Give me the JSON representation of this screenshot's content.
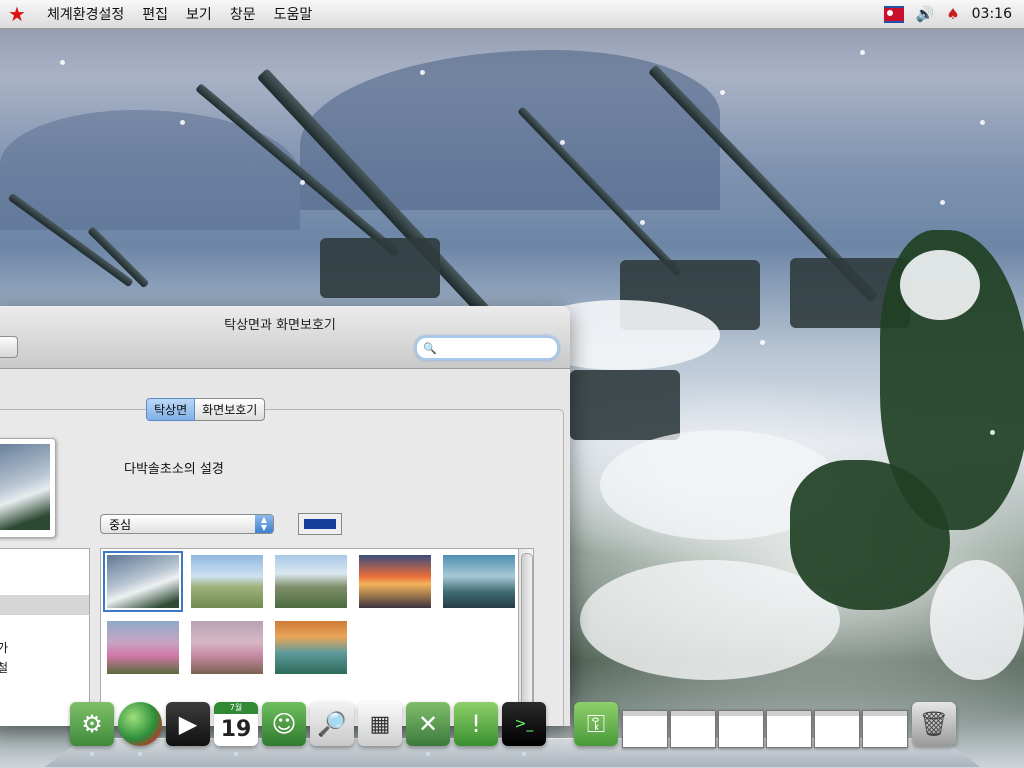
{
  "menubar": {
    "logo_icon": "red-star-icon",
    "menus": [
      "체계환경설정",
      "편집",
      "보기",
      "창문",
      "도움말"
    ],
    "status": {
      "flag_icon": "flag-icon",
      "volume_icon": "speaker-icon",
      "torch_icon": "torch-icon",
      "clock": "03:16"
    }
  },
  "window": {
    "title": "탁상면과 화면보호기",
    "search": {
      "placeholder": "",
      "value": ""
    },
    "tabs": [
      {
        "label": "탁상면",
        "active": true
      },
      {
        "label": "화면보호기",
        "active": false
      }
    ],
    "current_wallpaper_name": "다박솔초소의 설경",
    "position_popup": {
      "value": "중심"
    },
    "color_well": "#153e9a",
    "source_list": {
      "items": [
        "가",
        "철"
      ]
    },
    "thumbnails_count": 8
  },
  "dock": {
    "apps": [
      "system-preferences-icon",
      "web-browser-icon",
      "video-player-icon",
      "calendar-icon",
      "address-book-icon",
      "image-viewer-icon",
      "calculator-icon",
      "utilities-icon",
      "help-icon",
      "terminal-icon",
      "file-manager-icon"
    ],
    "calendar": {
      "month": "7월",
      "day": "19"
    },
    "minimized_windows": 6,
    "trash_icon": "trash-icon"
  }
}
